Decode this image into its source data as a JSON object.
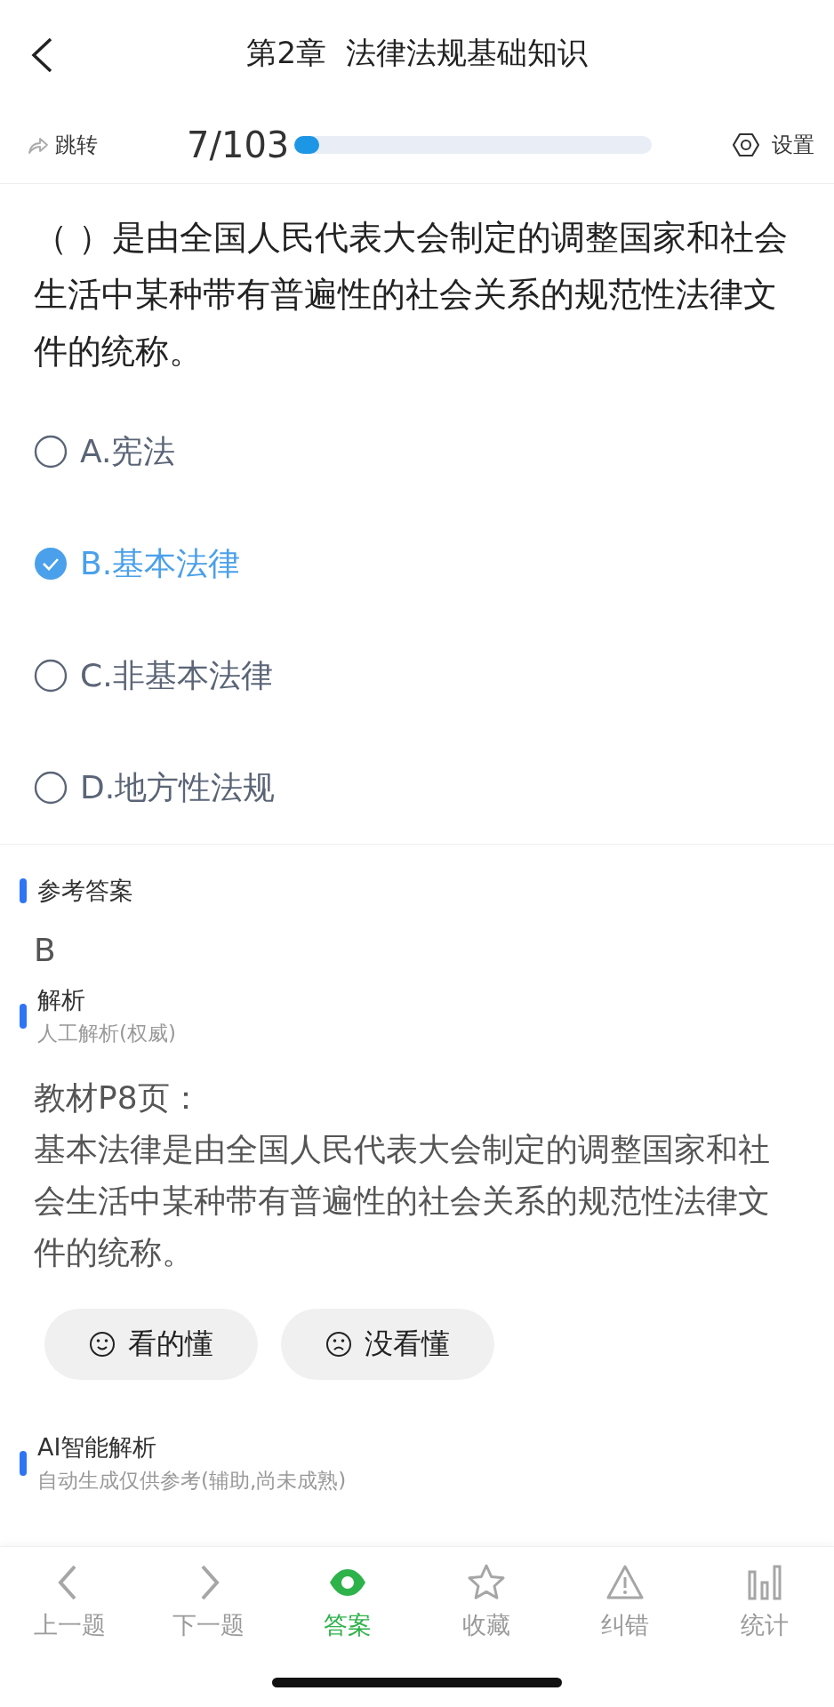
{
  "header": {
    "title": "第2章  法律法规基础知识"
  },
  "toolbar": {
    "jump_label": "跳转",
    "progress_text": "7/103",
    "progress": {
      "level": 0.068
    },
    "settings_label": "设置"
  },
  "question": {
    "text": "（ ）是由全国人民代表大会制定的调整国家和社会生活中某种带有普遍性的社会关系的规范性法律文件的统称。",
    "options": [
      {
        "label": "A.宪法",
        "selected": false
      },
      {
        "label": "B.基本法律",
        "selected": true
      },
      {
        "label": "C.非基本法律",
        "selected": false
      },
      {
        "label": "D.地方性法规",
        "selected": false
      }
    ]
  },
  "answer": {
    "heading": "参考答案",
    "value": "B"
  },
  "analysis": {
    "heading": "解析",
    "subtitle": "人工解析(权威)",
    "lines": [
      "教材P8页：",
      "基本法律是由全国人民代表大会制定的调整国家和社会生活中某种带有普遍性的社会关系的规范性法律文件的统称。"
    ],
    "feedback": [
      {
        "kind": "happy",
        "label": "看的懂"
      },
      {
        "kind": "sad",
        "label": "没看懂"
      }
    ]
  },
  "ai_analysis": {
    "heading": "AI智能解析",
    "subtitle": "自动生成仅供参考(辅助,尚未成熟)"
  },
  "tab_bar": [
    {
      "kind": "prev",
      "label": "上一题",
      "selected": false
    },
    {
      "kind": "next",
      "label": "下一题",
      "selected": false
    },
    {
      "kind": "eye",
      "label": "答案",
      "selected": true
    },
    {
      "kind": "star",
      "label": "收藏",
      "selected": false
    },
    {
      "kind": "warning",
      "label": "纠错",
      "selected": false
    },
    {
      "kind": "stats",
      "label": "统计",
      "selected": false
    }
  ]
}
